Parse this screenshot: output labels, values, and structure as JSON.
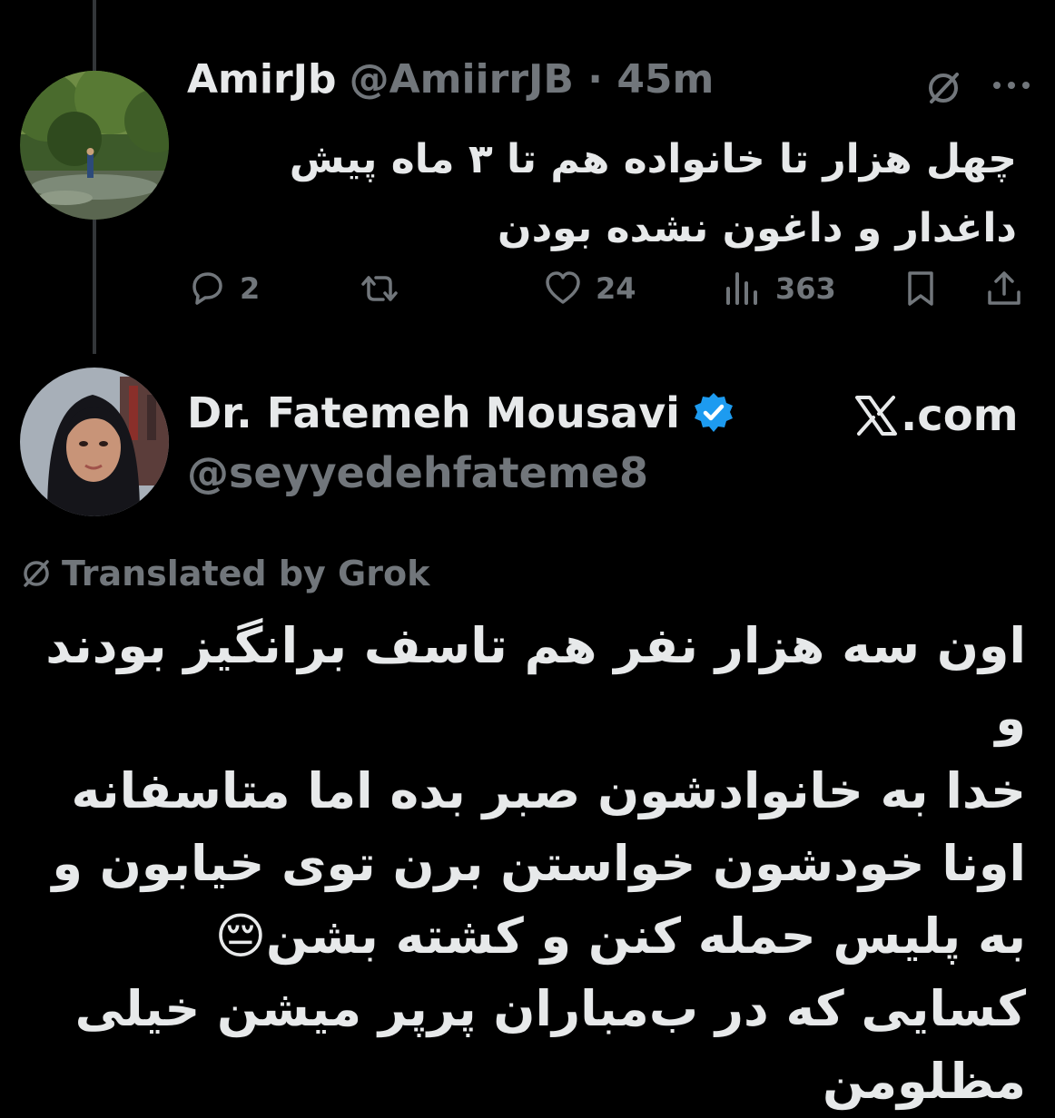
{
  "reply_tweet": {
    "display_name": "AmirJb",
    "handle": "@AmiirrJB",
    "separator": "·",
    "time": "45m",
    "text": "چهل هزار تا خانواده هم تا ۳ ماه پیش\nداغدار و داغون نشده بودن",
    "actions": {
      "reply_count": "2",
      "retweet_count": "",
      "like_count": "24",
      "view_count": "363"
    },
    "icons": [
      "grok-icon",
      "more-icon",
      "reply-icon",
      "retweet-icon",
      "heart-icon",
      "views-icon",
      "bookmark-icon",
      "share-icon"
    ]
  },
  "main_tweet": {
    "display_name": "Dr. Fatemeh Mousavi",
    "handle": "@seyyedehfateme8",
    "source": ".com",
    "translated_label": "Translated by Grok",
    "text": "اون سه هزار نفر هم تاسف برانگیز بودند و\nخدا به خانوادشون صبر بده اما متاسفانه\nاونا خودشون خواستن برن توی خیابون و\nبه پلیس حمله کنن و کشته بشن😔\nکسایی که در ب‌مباران پرپر میشن خیلی\nمظلومن",
    "icons": [
      "verified-icon",
      "x-logo-icon",
      "grok-icon"
    ]
  },
  "colors": {
    "background": "#000000",
    "primary_text": "#e7e9ea",
    "secondary_text": "#71767b",
    "verified_blue": "#1d9bf0",
    "thread_line": "#333639"
  }
}
